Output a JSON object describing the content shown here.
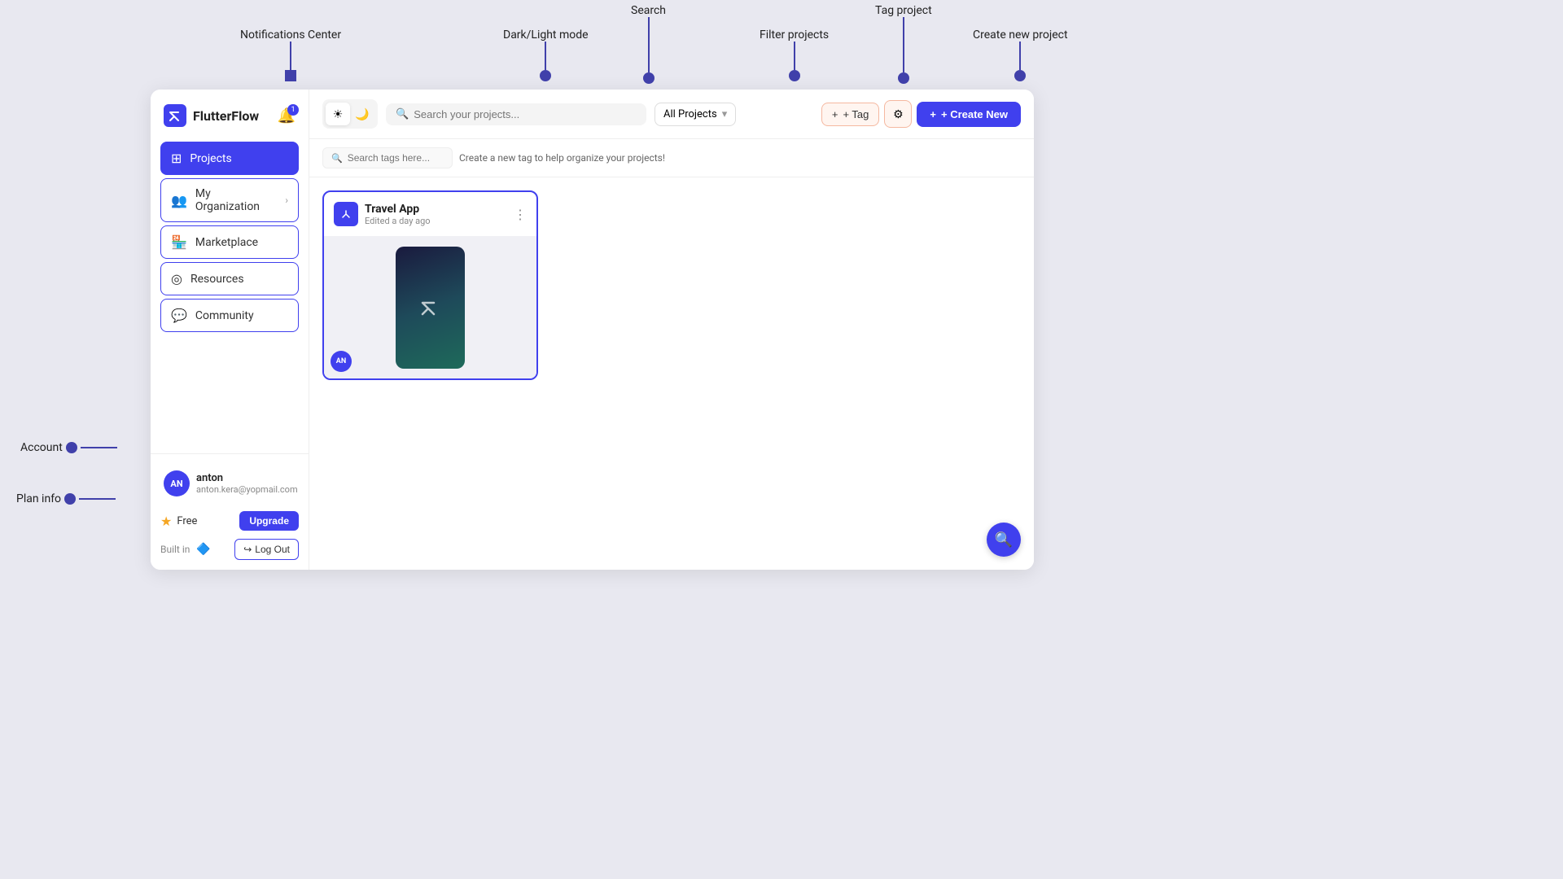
{
  "app": {
    "name": "FlutterFlow",
    "logo_alt": "FlutterFlow logo"
  },
  "header": {
    "notifications_label": "Notifications Center",
    "dark_light_label": "Dark/Light mode",
    "search_label": "Search",
    "filter_label": "Filter projects",
    "tag_label": "Tag project",
    "create_new_label": "Create new project"
  },
  "sidebar": {
    "items": [
      {
        "id": "projects",
        "label": "Projects",
        "active": true
      },
      {
        "id": "my-organization",
        "label": "My Organization"
      },
      {
        "id": "marketplace",
        "label": "Marketplace"
      },
      {
        "id": "resources",
        "label": "Resources"
      },
      {
        "id": "community",
        "label": "Community"
      }
    ]
  },
  "toolbar": {
    "light_icon": "☀",
    "dark_icon": "🌙",
    "search_placeholder": "Search your projects...",
    "filter_default": "All Projects",
    "tag_label": "+ Tag",
    "settings_icon": "⚙",
    "create_new_label": "+ Create New"
  },
  "tag_bar": {
    "search_placeholder": "Search tags here...",
    "hint": "Create a new tag to help organize your projects!"
  },
  "projects": [
    {
      "id": "travel-app",
      "title": "Travel App",
      "subtitle": "Edited a day ago",
      "avatar_initials": "AN"
    }
  ],
  "user": {
    "initials": "AN",
    "name": "anton",
    "email": "anton.kera@yopmail.com"
  },
  "plan": {
    "label": "Free",
    "upgrade_label": "Upgrade"
  },
  "built_in": {
    "label": "Built in",
    "logout_label": "Log Out"
  },
  "annotations": {
    "notifications_center": "Notifications Center",
    "dark_light_mode": "Dark/Light mode",
    "search": "Search",
    "filter_projects": "Filter projects",
    "tag_project": "Tag project",
    "create_new_project": "Create new project",
    "account": "Account",
    "plan_info": "Plan info"
  }
}
